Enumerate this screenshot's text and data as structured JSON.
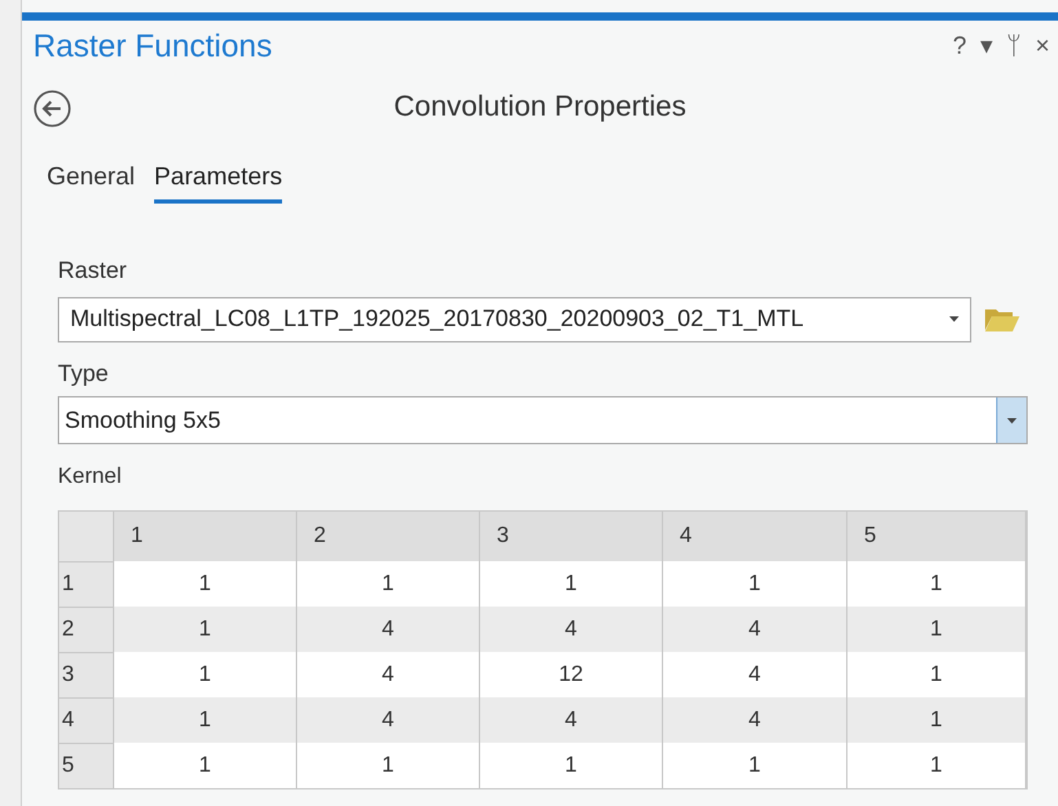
{
  "panel": {
    "title": "Raster Functions",
    "buttons": [
      "?",
      "▾",
      "ᛘ",
      "×"
    ]
  },
  "header": {
    "title": "Convolution Properties"
  },
  "tabs": [
    {
      "label": "General",
      "selected": false
    },
    {
      "label": "Parameters",
      "selected": true
    }
  ],
  "raster": {
    "label": "Raster",
    "value": "Multispectral_LC08_L1TP_192025_20170830_20200903_02_T1_MTL"
  },
  "type": {
    "label": "Type",
    "value": "Smoothing 5x5"
  },
  "kernel": {
    "label": "Kernel",
    "columns": [
      "1",
      "2",
      "3",
      "4",
      "5"
    ],
    "rows": [
      {
        "header": "1",
        "cells": [
          "1",
          "1",
          "1",
          "1",
          "1"
        ]
      },
      {
        "header": "2",
        "cells": [
          "1",
          "4",
          "4",
          "4",
          "1"
        ]
      },
      {
        "header": "3",
        "cells": [
          "1",
          "4",
          "12",
          "4",
          "1"
        ]
      },
      {
        "header": "4",
        "cells": [
          "1",
          "4",
          "4",
          "4",
          "1"
        ]
      },
      {
        "header": "5",
        "cells": [
          "1",
          "1",
          "1",
          "1",
          "1"
        ]
      }
    ]
  }
}
